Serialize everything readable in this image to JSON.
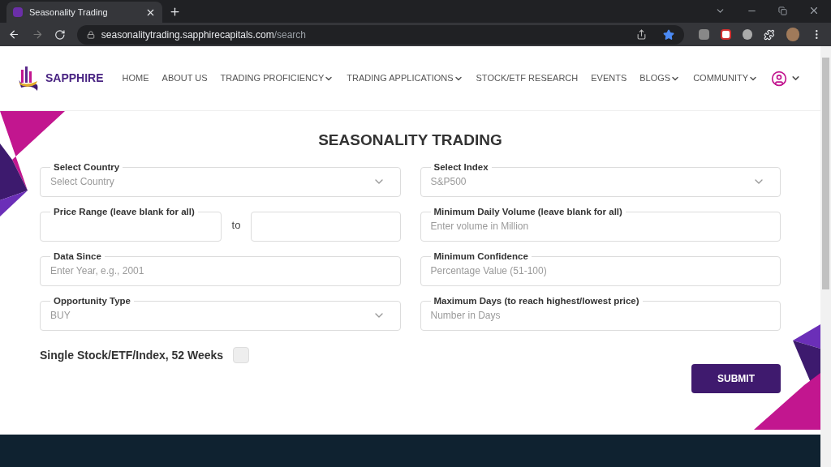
{
  "browser": {
    "tab_title": "Seasonality Trading",
    "url_host": "seasonalitytrading.sapphirecapitals.com",
    "url_path": "/search"
  },
  "header": {
    "logo_text": "SAPPHIRE",
    "nav": [
      {
        "label": "HOME",
        "has_menu": false
      },
      {
        "label": "ABOUT US",
        "has_menu": false
      },
      {
        "label": "TRADING PROFICIENCY",
        "has_menu": true
      },
      {
        "label": "TRADING APPLICATIONS",
        "has_menu": true
      },
      {
        "label": "STOCK/ETF RESEARCH",
        "has_menu": false
      },
      {
        "label": "EVENTS",
        "has_menu": false
      },
      {
        "label": "BLOGS",
        "has_menu": true
      },
      {
        "label": "COMMUNITY",
        "has_menu": true
      }
    ]
  },
  "form": {
    "title": "SEASONALITY TRADING",
    "left": [
      {
        "kind": "select",
        "label": "Select Country",
        "placeholder": "Select Country"
      },
      {
        "kind": "range",
        "label": "Price Range (leave blank for all)",
        "separator": "to"
      },
      {
        "kind": "input",
        "label": "Data Since",
        "placeholder": "Enter Year, e.g., 2001"
      },
      {
        "kind": "select",
        "label": "Opportunity Type",
        "value": "BUY"
      }
    ],
    "right": [
      {
        "kind": "select",
        "label": "Select Index",
        "value": "S&P500"
      },
      {
        "kind": "input",
        "label": "Minimum Daily Volume (leave blank for all)",
        "placeholder": "Enter volume in Million"
      },
      {
        "kind": "input",
        "label": "Minimum Confidence",
        "placeholder": "Percentage Value (51-100)"
      },
      {
        "kind": "input",
        "label": "Maximum Days (to reach highest/lowest price)",
        "placeholder": "Number in Days"
      }
    ],
    "checkbox": {
      "label": "Single Stock/ETF/Index, 52 Weeks",
      "checked": false
    },
    "submit": "SUBMIT"
  }
}
